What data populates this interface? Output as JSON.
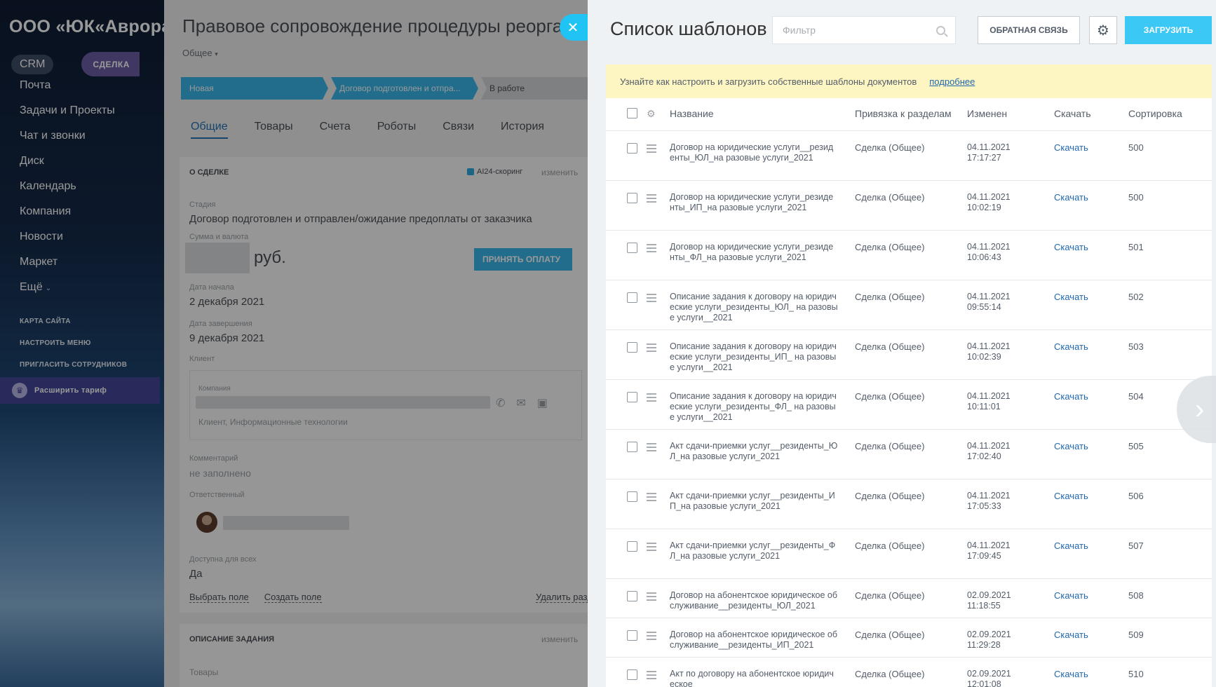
{
  "sidebar": {
    "company": "ООО «ЮК«Аврора»",
    "crm": "CRM",
    "deal_badge": "СДЕЛКА",
    "menu": [
      "Почта",
      "Задачи и Проекты",
      "Чат и звонки",
      "Диск",
      "Календарь",
      "Компания",
      "Новости",
      "Маркет",
      "Ещё"
    ],
    "submenu": [
      "Карта сайта",
      "Настроить меню",
      "Пригласить сотрудников"
    ],
    "upgrade": "Расширить тариф"
  },
  "deal": {
    "title": "Правовое сопровождение процедуры  реорганизации",
    "subtitle": "Общее",
    "stages": [
      "Новая",
      "Договор подготовлен и отпра...",
      "В работе"
    ],
    "tabs": [
      "Общие",
      "Товары",
      "Счета",
      "Роботы",
      "Связи",
      "История"
    ],
    "card_title": "О сделке",
    "ai_scoring": "AI24-скоринг",
    "change": "изменить",
    "stage_label": "Стадия",
    "stage_value": "Договор подготовлен и отправлен/ожидание предоплаты от заказчика",
    "amount_label": "Сумма и валюта",
    "amount_currency": "руб.",
    "pay_button": "ПРИНЯТЬ ОПЛАТУ",
    "start_label": "Дата начала",
    "start_value": "2 декабря 2021",
    "end_label": "Дата завершения",
    "end_value": "9 декабря 2021",
    "client_label": "Клиент",
    "company_label": "Компания",
    "client_type": "Клиент, Информационные технологии",
    "comment_label": "Комментарий",
    "comment_value": "не заполнено",
    "responsible_label": "Ответственный",
    "available_label": "Доступна для всех",
    "available_value": "Да",
    "select_field": "Выбрать поле",
    "create_field": "Создать поле",
    "delete_section": "Удалить раздел",
    "task_title": "Описание задания",
    "task_change": "изменить",
    "products_label": "Товары"
  },
  "panel": {
    "title": "Список шаблонов",
    "filter_placeholder": "Фильтр",
    "feedback": "ОБРАТНАЯ СВЯЗЬ",
    "upload": "ЗАГРУЗИТЬ",
    "info_text": "Узнайте как настроить и загрузить собственные шаблоны документов",
    "info_link": "подробнее",
    "columns": {
      "name": "Название",
      "binding": "Привязка к разделам",
      "changed": "Изменен",
      "download": "Скачать",
      "sort": "Сортировка"
    },
    "rows": [
      {
        "name": "Договор на юридические услуги__резиденты_ЮЛ_на разовые услуги_2021",
        "binding": "Сделка (Общее)",
        "date": "04.11.2021",
        "time": "17:17:27",
        "download": "Скачать",
        "sort": "500"
      },
      {
        "name": "Договор на юридические услуги_резиденты_ИП_на разовые услуги_2021",
        "binding": "Сделка (Общее)",
        "date": "04.11.2021",
        "time": "10:02:19",
        "download": "Скачать",
        "sort": "500"
      },
      {
        "name": "Договор на юридические услуги_резиденты_ФЛ_на разовые услуги_2021",
        "binding": "Сделка (Общее)",
        "date": "04.11.2021",
        "time": "10:06:43",
        "download": "Скачать",
        "sort": "501"
      },
      {
        "name": "Описание задания к договору на юридические услуги_резиденты_ЮЛ_ на разовые услуги__2021",
        "binding": "Сделка (Общее)",
        "date": "04.11.2021",
        "time": "09:55:14",
        "download": "Скачать",
        "sort": "502"
      },
      {
        "name": "Описание задания к договору на юридические услуги_резиденты_ИП_ на разовые услуги__2021",
        "binding": "Сделка (Общее)",
        "date": "04.11.2021",
        "time": "10:02:39",
        "download": "Скачать",
        "sort": "503"
      },
      {
        "name": "Описание задания к договору на юридические услуги_резиденты_ФЛ_ на разовые услуги__2021",
        "binding": "Сделка (Общее)",
        "date": "04.11.2021",
        "time": "10:11:01",
        "download": "Скачать",
        "sort": "504"
      },
      {
        "name": "Акт сдачи-приемки услуг__резиденты_ЮЛ_на разовые услуги_2021",
        "binding": "Сделка (Общее)",
        "date": "04.11.2021",
        "time": "17:02:40",
        "download": "Скачать",
        "sort": "505"
      },
      {
        "name": "Акт сдачи-приемки услуг__резиденты_ИП_на разовые услуги_2021",
        "binding": "Сделка (Общее)",
        "date": "04.11.2021",
        "time": "17:05:33",
        "download": "Скачать",
        "sort": "506"
      },
      {
        "name": "Акт сдачи-приемки услуг__резиденты_ФЛ_на разовые услуги_2021",
        "binding": "Сделка (Общее)",
        "date": "04.11.2021",
        "time": "17:09:45",
        "download": "Скачать",
        "sort": "507"
      },
      {
        "name": "Договор на абонентское юридическое обслуживание__резиденты_ЮЛ_2021",
        "binding": "Сделка (Общее)",
        "date": "02.09.2021",
        "time": "11:18:55",
        "download": "Скачать",
        "sort": "508"
      },
      {
        "name": "Договор на абонентское юридическое обслуживание__резиденты_ИП_2021",
        "binding": "Сделка (Общее)",
        "date": "02.09.2021",
        "time": "11:29:28",
        "download": "Скачать",
        "sort": "509"
      },
      {
        "name": "Акт по договору на абонентское юридическое",
        "binding": "Сделка (Общее)",
        "date": "02.09.2021",
        "time": "12:01:08",
        "download": "Скачать",
        "sort": "510"
      }
    ]
  }
}
